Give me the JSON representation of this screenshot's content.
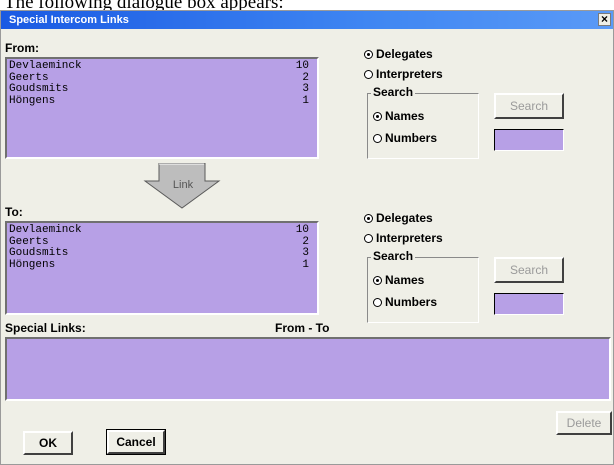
{
  "caption": "The following dialogue box appears:",
  "window": {
    "title": "Special Intercom Links",
    "close_glyph": "×"
  },
  "from": {
    "label": "From:",
    "rows": [
      {
        "name": "Devlaeminck",
        "num": "10"
      },
      {
        "name": "Geerts",
        "num": "2"
      },
      {
        "name": "Goudsmits",
        "num": "3"
      },
      {
        "name": "Höngens",
        "num": "1"
      }
    ],
    "radio_delegates": "Delegates",
    "radio_interpreters": "Interpreters",
    "search_group": "Search",
    "radio_names": "Names",
    "radio_numbers": "Numbers",
    "search_button": "Search"
  },
  "link_button": "Link",
  "to": {
    "label": "To:",
    "rows": [
      {
        "name": "Devlaeminck",
        "num": "10"
      },
      {
        "name": "Geerts",
        "num": "2"
      },
      {
        "name": "Goudsmits",
        "num": "3"
      },
      {
        "name": "Höngens",
        "num": "1"
      }
    ],
    "radio_delegates": "Delegates",
    "radio_interpreters": "Interpreters",
    "search_group": "Search",
    "radio_names": "Names",
    "radio_numbers": "Numbers",
    "search_button": "Search"
  },
  "special_links": {
    "label": "Special Links:",
    "column_label": "From - To"
  },
  "buttons": {
    "delete": "Delete",
    "ok": "OK",
    "cancel": "Cancel"
  },
  "colors": {
    "list_bg": "#b7a0e6",
    "dialog_bg": "#efefe7",
    "title_bar": "#2b6fe8"
  }
}
